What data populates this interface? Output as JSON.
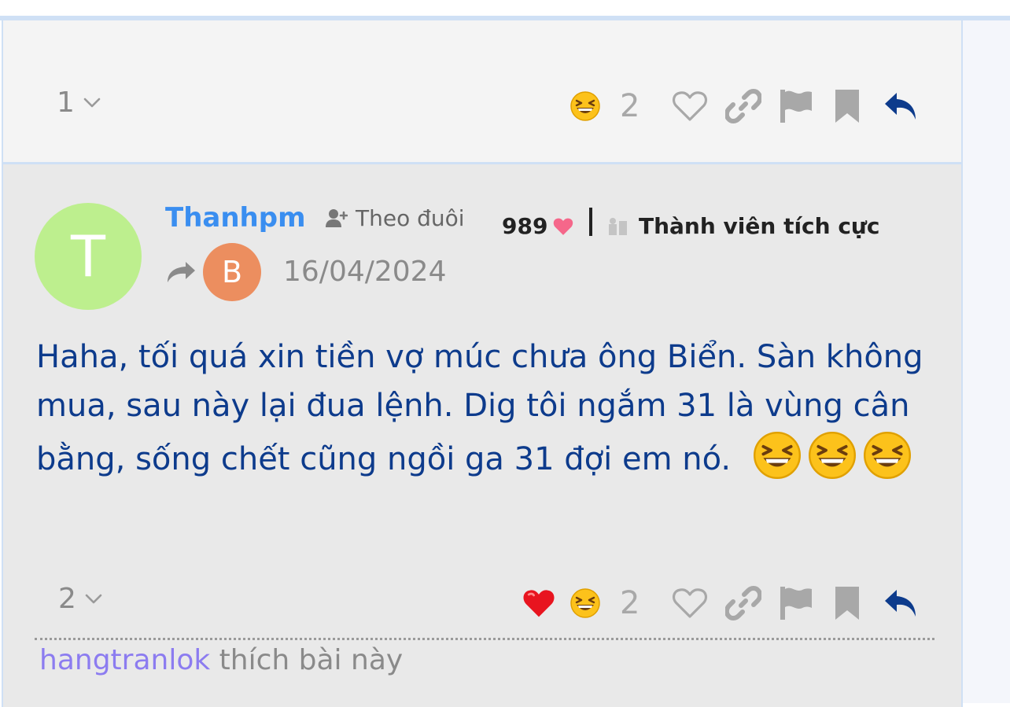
{
  "post1": {
    "reply_count": "1",
    "reaction_count": "2",
    "icons": [
      "grinning-squinting-face-icon",
      "heart-outline-icon",
      "link-icon",
      "flag-icon",
      "bookmark-icon",
      "reply-arrow-icon"
    ]
  },
  "post2": {
    "author": {
      "initial": "T",
      "name": "Thanhpm",
      "follow_label": "Theo đuôi",
      "likes_received": "989",
      "rank": "Thành viên tích cực"
    },
    "reply_to_initial": "B",
    "date": "16/04/2024",
    "content": "Haha, tối quá xin tiền vợ múc chưa ông Biển. Sàn không mua, sau này lại đua lệnh. Dig tôi ngắm 31 là vùng cân bằng, sống chết cũng ngồi ga 31 đợi em nó.",
    "content_emojis": [
      "grinning-squinting-face",
      "grinning-squinting-face",
      "grinning-squinting-face"
    ],
    "reply_count": "2",
    "reaction_count": "2",
    "reactions": [
      "red-heart",
      "grinning-squinting-face"
    ],
    "liked_by_user": "hangtranlok",
    "liked_by_suffix": " thích bài này"
  },
  "colors": {
    "username": "#3a8ef0",
    "content_text": "#0d3b8c",
    "reply_icon": "#0d3b8c",
    "avatar_T": "#bdef8e",
    "avatar_B": "#ec8e5f",
    "heart_pink": "#f5678a",
    "liked_user": "#8c7cf0"
  }
}
